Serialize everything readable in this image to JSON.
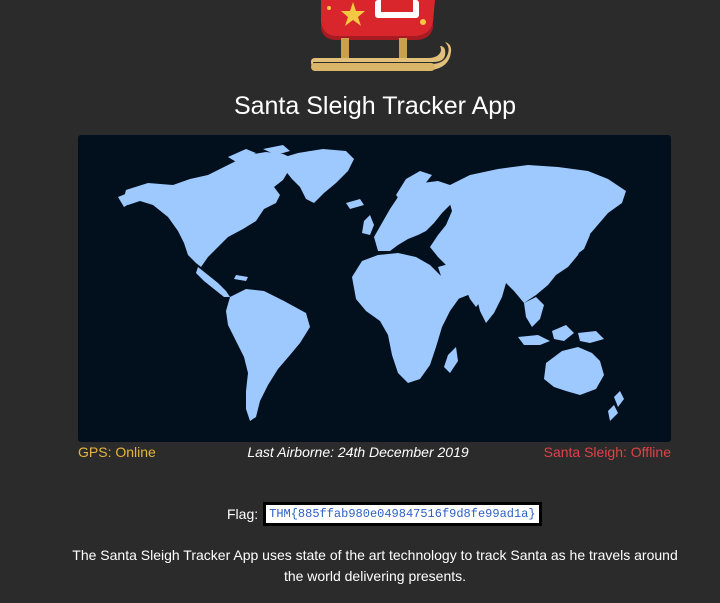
{
  "app": {
    "title": "Santa Sleigh Tracker App"
  },
  "status": {
    "gps": "GPS: Online",
    "last_airborne": "Last Airborne: 24th December 2019",
    "sleigh": "Santa Sleigh: Offline"
  },
  "flag": {
    "label": "Flag:",
    "value": "THM{885ffab980e049847516f9d8fe99ad1a}"
  },
  "description": "The Santa Sleigh Tracker App uses state of the art technology to track Santa as he travels around the world delivering presents.",
  "colors": {
    "background": "#2b2b2b",
    "map_background": "#020f1d",
    "land": "#9ec9ff",
    "gps_online": "#e6b53a",
    "sleigh_offline": "#e0414a",
    "flag_text": "#2c5fc4"
  },
  "icons": {
    "logo": "sleigh-icon"
  }
}
